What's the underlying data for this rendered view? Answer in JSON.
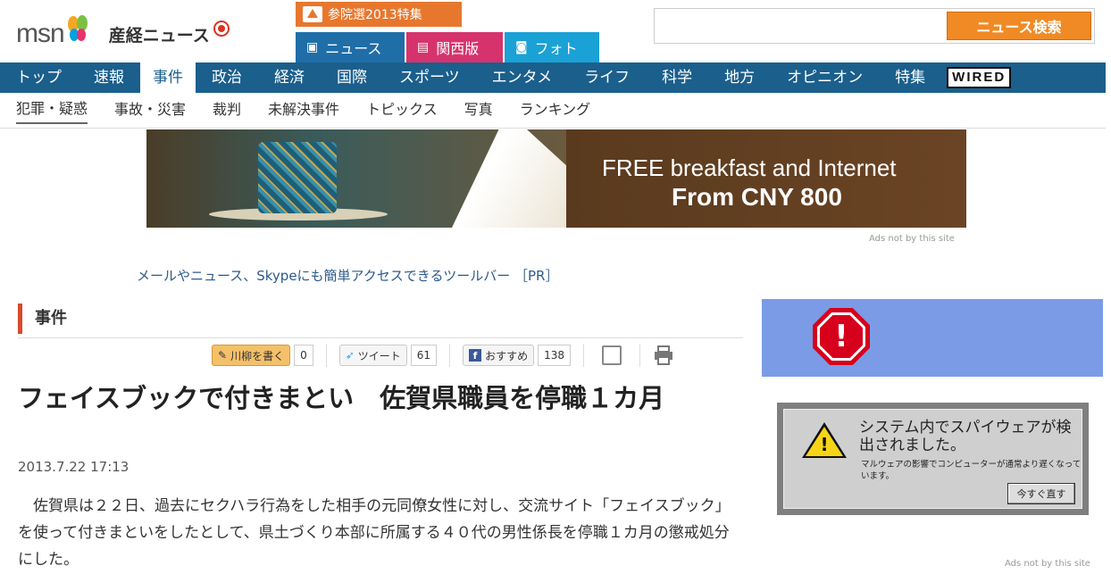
{
  "header": {
    "logo_msn": "msn",
    "logo_sankei": "産経ニュース",
    "election_banner": "参院選2013特集",
    "service_tabs": [
      {
        "label": "ニュース",
        "icon": "tablet-icon"
      },
      {
        "label": "関西版",
        "icon": "document-icon"
      },
      {
        "label": "フォト",
        "icon": "camera-icon"
      }
    ],
    "search": {
      "value": "",
      "placeholder": "",
      "button_label": "ニュース検索"
    }
  },
  "main_nav": {
    "items": [
      "トップ",
      "速報",
      "事件",
      "政治",
      "経済",
      "国際",
      "スポーツ",
      "エンタメ",
      "ライフ",
      "科学",
      "地方",
      "オピニオン",
      "特集"
    ],
    "active": "事件",
    "wired_logo": "WIRED"
  },
  "sub_nav": {
    "items": [
      "犯罪・疑惑",
      "事故・災害",
      "裁判",
      "未解決事件",
      "トピックス",
      "写真",
      "ランキング"
    ],
    "active": "犯罪・疑惑"
  },
  "banner_ad": {
    "line1": "FREE breakfast and Internet",
    "line2": "From CNY 800",
    "ads_note": "Ads not by this site"
  },
  "toolbar_ad": "メールやニュース、Skypeにも簡単アクセスできるツールバー ［PR］",
  "article": {
    "category": "事件",
    "share": {
      "write_label": "川柳を書く",
      "write_count": "0",
      "tweet_label": "ツイート",
      "tweet_count": "61",
      "like_label": "おすすめ",
      "like_count": "138"
    },
    "headline": "フェイスブックで付きまとい　佐賀県職員を停職１カ月",
    "date": "2013.7.22 17:13",
    "body": "佐賀県は２２日、過去にセクハラ行為をした相手の元同僚女性に対し、交流サイト「フェイスブック」を使って付きまといをしたとして、県土づくり本部に所属する４０代の男性係長を停職１カ月の懲戒処分にした。"
  },
  "sidebar": {
    "alert_symbol": "!",
    "warning": {
      "title": "システム内でスパイウェアが検出されました。",
      "subtitle": "マルウェアの影響でコンピューターが通常より遅くなっています。",
      "button": "今すぐ直す"
    },
    "ads_note": "Ads not by this site"
  },
  "colors": {
    "nav_blue": "#1b5f8c",
    "search_orange": "#f08a24",
    "category_red": "#d94a2b",
    "tab_news": "#1f6ea8",
    "tab_kansai": "#d6336c",
    "tab_photo": "#1aa1d6"
  }
}
